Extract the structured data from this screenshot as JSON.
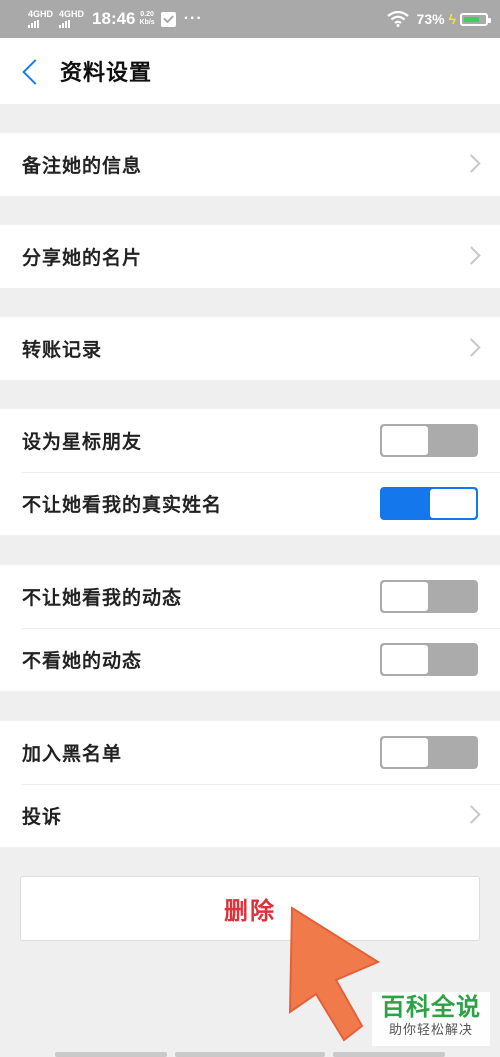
{
  "status_bar": {
    "network_1": "4GHD",
    "network_2": "4GHD",
    "time": "18:46",
    "speed_value": "0.20",
    "speed_unit": "Kb/s",
    "more": "···",
    "battery_percent": "73%",
    "wifi_icon": "wifi-icon",
    "battery_level": 0.73,
    "battery_color": "#39d353"
  },
  "nav": {
    "back_icon": "chevron-left-icon",
    "title": "资料设置"
  },
  "groups": [
    {
      "items": [
        {
          "label": "备注她的信息",
          "control": "chevron"
        }
      ]
    },
    {
      "items": [
        {
          "label": "分享她的名片",
          "control": "chevron"
        }
      ]
    },
    {
      "items": [
        {
          "label": "转账记录",
          "control": "chevron"
        }
      ]
    },
    {
      "items": [
        {
          "label": "设为星标朋友",
          "control": "toggle",
          "on": false
        },
        {
          "label": "不让她看我的真实姓名",
          "control": "toggle",
          "on": true
        }
      ]
    },
    {
      "items": [
        {
          "label": "不让她看我的动态",
          "control": "toggle",
          "on": false
        },
        {
          "label": "不看她的动态",
          "control": "toggle",
          "on": false
        }
      ]
    },
    {
      "items": [
        {
          "label": "加入黑名单",
          "control": "toggle",
          "on": false
        },
        {
          "label": "投诉",
          "control": "chevron"
        }
      ]
    }
  ],
  "delete_button": {
    "label": "删除",
    "color": "#e0303a"
  },
  "colors": {
    "accent": "#1577ec",
    "toggle_off": "#ababab",
    "arrow": "#f07a4a"
  },
  "watermark": {
    "title": "百科全说",
    "subtitle": "助你轻松解决"
  }
}
